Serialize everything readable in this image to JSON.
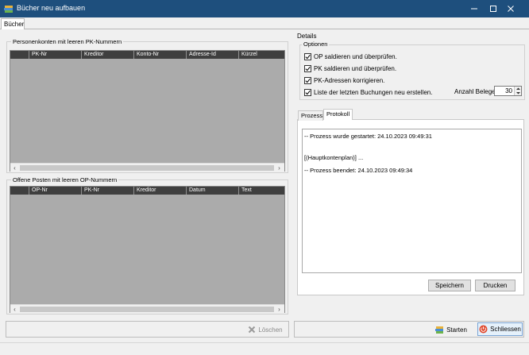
{
  "window": {
    "title": "Bücher neu aufbauen",
    "minimize_glyph": "minimize-icon",
    "maximize_glyph": "maximize-icon",
    "close_glyph": "close-icon"
  },
  "tabs": [
    {
      "label": "Bücher",
      "active": true
    }
  ],
  "left": {
    "personenkonten": {
      "label": "Personenkonten mit leeren PK-Nummern",
      "columns": [
        "PK-Nr",
        "Kreditor",
        "Konto-Nr",
        "Adresse-Id",
        "Kürzel"
      ]
    },
    "offene_posten": {
      "label": "Offene Posten mit leeren OP-Nummern",
      "columns": [
        "OP-Nr",
        "PK-Nr",
        "Kreditor",
        "Datum",
        "Text"
      ]
    },
    "scroll_left": "‹",
    "scroll_right": "›",
    "loeschen_label": "Löschen"
  },
  "details": {
    "label": "Details",
    "optionen_label": "Optionen",
    "options": [
      {
        "label": "OP saldieren und überprüfen.",
        "checked": true
      },
      {
        "label": "PK saldieren und überprüfen.",
        "checked": true
      },
      {
        "label": "PK-Adressen korrigieren.",
        "checked": true
      },
      {
        "label": "Liste der letzten Buchungen neu erstellen.",
        "checked": true
      }
    ],
    "anzahl_belege_label": "Anzahl Belege",
    "anzahl_belege_value": "30",
    "inner_tabs": [
      {
        "label": "Prozess",
        "active": false
      },
      {
        "label": "Protokoll",
        "active": true
      }
    ],
    "log_lines": [
      "-- Prozess wurde gestartet: 24.10.2023 09:49:31",
      "",
      "[(Hauptkontenplan)] ...",
      "-- Prozess beendet: 24.10.2023 09:49:34"
    ],
    "speichern_label": "Speichern",
    "drucken_label": "Drucken"
  },
  "bottom": {
    "starten_label": "Starten",
    "schliessen_label": "Schliessen"
  },
  "colors": {
    "titlebar": "#1e4f7d",
    "grid_bg": "#ababab",
    "grid_header": "#3f3f3f",
    "close_icon": "#e0462b"
  }
}
